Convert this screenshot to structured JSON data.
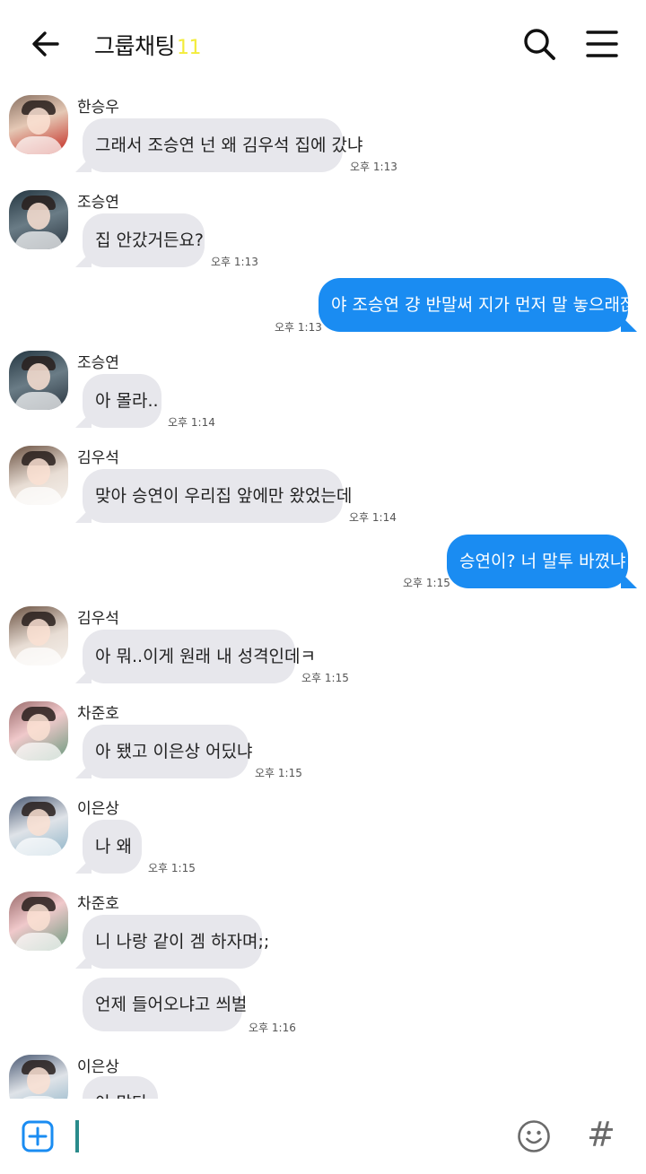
{
  "header": {
    "title": "그룹채팅",
    "count": "11"
  },
  "icons": {
    "back": "arrow-left-icon",
    "search": "search-icon",
    "menu": "hamburger-menu-icon",
    "add": "plus-square-icon",
    "emoji": "smiley-icon",
    "hashtag": "hashtag-icon"
  },
  "colors": {
    "outgoing_bubble": "#1a8cf2",
    "incoming_bubble": "#e7e7ec",
    "count_accent": "#f3ec3b",
    "cursor": "#2a8b8b"
  },
  "messages": [
    {
      "sender": "한승우",
      "text": "그래서 조승연 넌 왜 김우석 집에 갔냐",
      "time": "오후 1:13"
    },
    {
      "sender": "조승연",
      "text": "집 안갔거든요?",
      "time": "오후 1:13"
    },
    {
      "sender": "me",
      "text": "야 조승연 걍 반말써 지가 먼저 말 놓으래잖어",
      "time": "오후 1:13"
    },
    {
      "sender": "조승연",
      "text": "아 몰라..",
      "time": "오후 1:14"
    },
    {
      "sender": "김우석",
      "text": "맞아 승연이 우리집 앞에만 왔었는데",
      "time": "오후 1:14"
    },
    {
      "sender": "me",
      "text": "승연이? 너 말투 바꼈냐ㅋ",
      "time": "오후 1:15"
    },
    {
      "sender": "김우석",
      "text": "아 뭐..이게 원래 내 성격인데ㅋ",
      "time": "오후 1:15"
    },
    {
      "sender": "차준호",
      "text": "아 됐고 이은상 어딨냐",
      "time": "오후 1:15"
    },
    {
      "sender": "이은상",
      "text": "나 왜",
      "time": "오후 1:15"
    },
    {
      "sender": "차준호",
      "text": "니 나랑 같이 겜 하자며;;",
      "time": ""
    },
    {
      "sender": "차준호",
      "text": "언제 들어오냐고 씌벌",
      "time": "오후 1:16"
    },
    {
      "sender": "이은상",
      "text": "아 맞다",
      "time": ""
    }
  ]
}
